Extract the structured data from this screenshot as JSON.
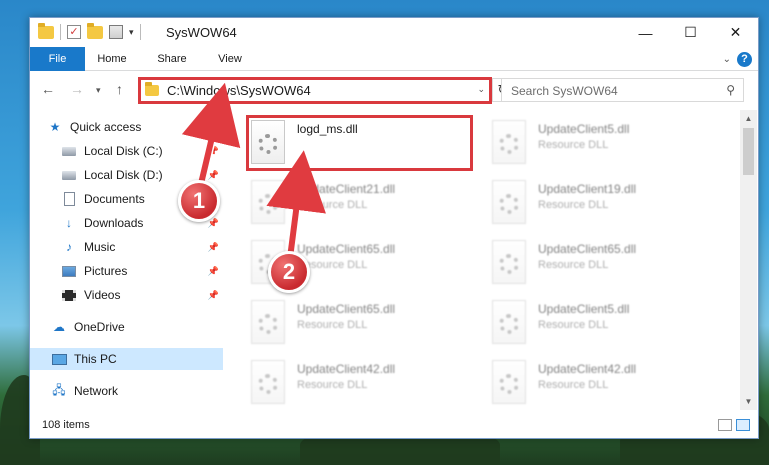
{
  "window": {
    "title": "SysWOW64"
  },
  "caption": {
    "minimize": "—",
    "maximize": "☐",
    "close": "✕"
  },
  "ribbon": {
    "tabs": [
      "File",
      "Home",
      "Share",
      "View"
    ]
  },
  "address": {
    "path": "C:\\Windows\\SysWOW64",
    "search_placeholder": "Search SysWOW64"
  },
  "nav_pane": {
    "items": [
      {
        "label": "Quick access",
        "icon": "star-icon"
      },
      {
        "label": "Local Disk (C:)",
        "icon": "drive-icon",
        "pinned": true
      },
      {
        "label": "Local Disk (D:)",
        "icon": "drive-icon",
        "pinned": true
      },
      {
        "label": "Documents",
        "icon": "documents-icon",
        "pinned": true
      },
      {
        "label": "Downloads",
        "icon": "downloads-icon",
        "pinned": true
      },
      {
        "label": "Music",
        "icon": "music-icon",
        "pinned": true
      },
      {
        "label": "Pictures",
        "icon": "pictures-icon",
        "pinned": true
      },
      {
        "label": "Videos",
        "icon": "videos-icon",
        "pinned": true
      },
      {
        "label": "OneDrive",
        "icon": "onedrive-icon"
      },
      {
        "label": "This PC",
        "icon": "pc-icon",
        "selected": true
      },
      {
        "label": "Network",
        "icon": "network-icon"
      }
    ]
  },
  "files": [
    {
      "name": "logd_ms.dll",
      "type": "",
      "highlighted": true
    },
    {
      "name": "UpdateClient5.dll",
      "type": "Resource DLL"
    },
    {
      "name": "UpdateClient21.dll",
      "type": "Resource DLL"
    },
    {
      "name": "UpdateClient19.dll",
      "type": "Resource DLL"
    },
    {
      "name": "UpdateClient65.dll",
      "type": "Resource DLL"
    },
    {
      "name": "UpdateClient65.dll",
      "type": "Resource DLL"
    },
    {
      "name": "UpdateClient65.dll",
      "type": "Resource DLL"
    },
    {
      "name": "UpdateClient5.dll",
      "type": "Resource DLL"
    },
    {
      "name": "UpdateClient42.dll",
      "type": "Resource DLL"
    },
    {
      "name": "UpdateClient42.dll",
      "type": "Resource DLL"
    }
  ],
  "status": {
    "item_count": "108 items"
  },
  "annotations": {
    "badge1": "1",
    "badge2": "2"
  },
  "colors": {
    "accent": "#1979ca",
    "highlight": "#d9393e"
  }
}
